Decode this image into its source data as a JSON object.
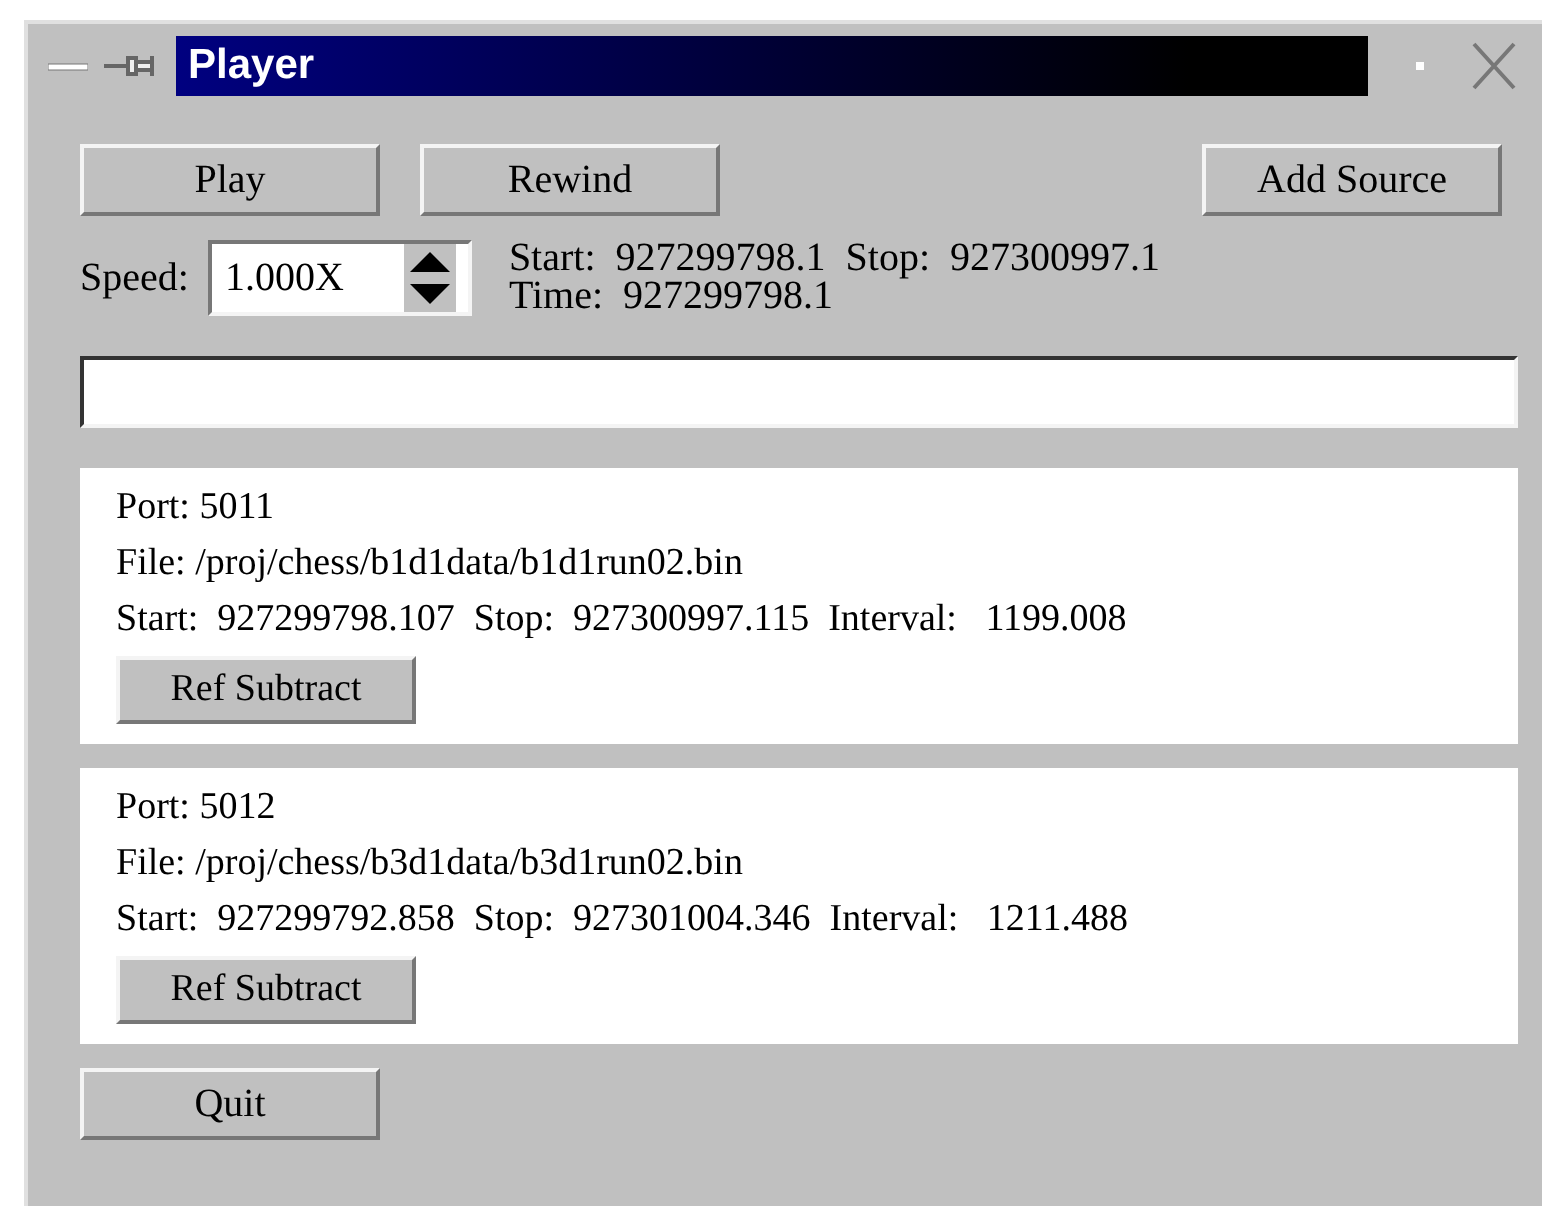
{
  "window": {
    "title": "Player"
  },
  "buttons": [
    {
      "label": "Play"
    },
    {
      "label": "Rewind"
    },
    {
      "label": "Add Source"
    }
  ],
  "speed": {
    "label": "Speed:",
    "value": "1.000X"
  },
  "times": {
    "start_label": "Start:",
    "start": "927299798.1",
    "stop_label": "Stop:",
    "stop": "927300997.1",
    "time_label": "Time:",
    "time": "927299798.1"
  },
  "sources": [
    {
      "port": "Port: 5011",
      "file": "File: /proj/chess/b1d1data/b1d1run02.bin",
      "stats": "Start:  927299798.107  Stop:  927300997.115  Interval:   1199.008",
      "button": "Ref Subtract"
    },
    {
      "port": "Port: 5012",
      "file": "File: /proj/chess/b3d1data/b3d1run02.bin",
      "stats": "Start:  927299792.858  Stop:  927301004.346  Interval:   1211.488",
      "button": "Ref Subtract"
    }
  ],
  "quit": {
    "label": "Quit"
  }
}
